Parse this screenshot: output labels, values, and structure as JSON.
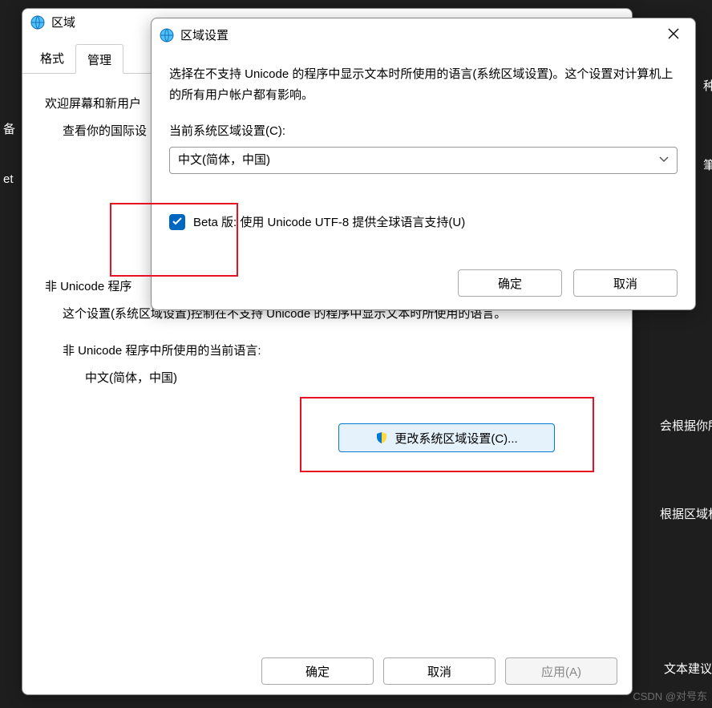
{
  "background": {
    "snippet1": "备",
    "snippet2": "et",
    "snippet3": "种",
    "snippet4": "筆",
    "snippet5": "会根据你所在的",
    "snippet6": "根据区域格式设",
    "snippet7": "文本建议"
  },
  "parent": {
    "title": "区域",
    "tabs": {
      "format": "格式",
      "admin": "管理"
    },
    "welcome_group": "欢迎屏幕和新用户",
    "welcome_desc": "查看你的国际设",
    "nonuni_group": "非 Unicode 程序",
    "nonuni_desc": "这个设置(系统区域设置)控制在不支持 Unicode 的程序中显示文本时所使用的语言。",
    "nonuni_label": "非 Unicode 程序中所使用的当前语言:",
    "nonuni_value": "中文(简体，中国)",
    "change_btn": "更改系统区域设置(C)...",
    "buttons": {
      "ok": "确定",
      "cancel": "取消",
      "apply": "应用(A)"
    }
  },
  "dialog": {
    "title": "区域设置",
    "desc": "选择在不支持 Unicode 的程序中显示文本时所使用的语言(系统区域设置)。这个设置对计算机上的所有用户帐户都有影响。",
    "combo_label": "当前系统区域设置(C):",
    "combo_value": "中文(简体，中国)",
    "beta_label": "Beta 版: 使用 Unicode UTF-8 提供全球语言支持(U)",
    "ok": "确定",
    "cancel": "取消"
  },
  "watermark": "CSDN @对号东"
}
